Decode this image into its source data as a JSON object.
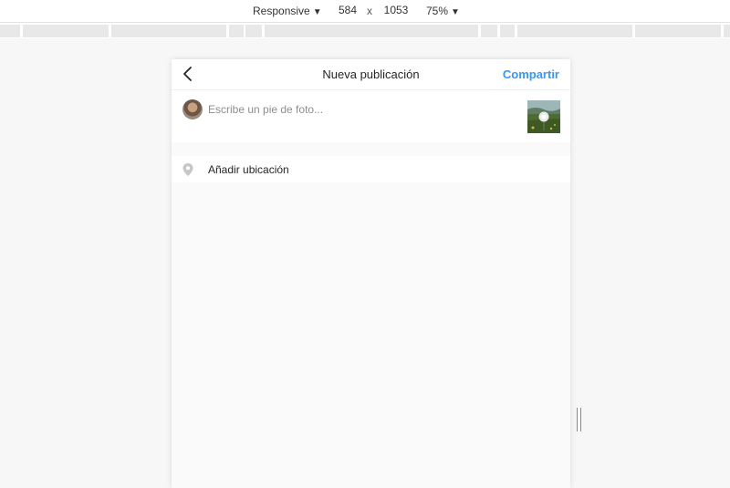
{
  "devtools": {
    "device_mode": "Responsive",
    "width": "584",
    "height": "1053",
    "times": "x",
    "zoom": "75%"
  },
  "header": {
    "title": "Nueva publicación",
    "share_label": "Compartir"
  },
  "caption": {
    "placeholder": "Escribe un pie de foto..."
  },
  "location": {
    "label": "Añadir ubicación"
  },
  "colors": {
    "accent": "#3897f0",
    "background": "#fafafa"
  }
}
